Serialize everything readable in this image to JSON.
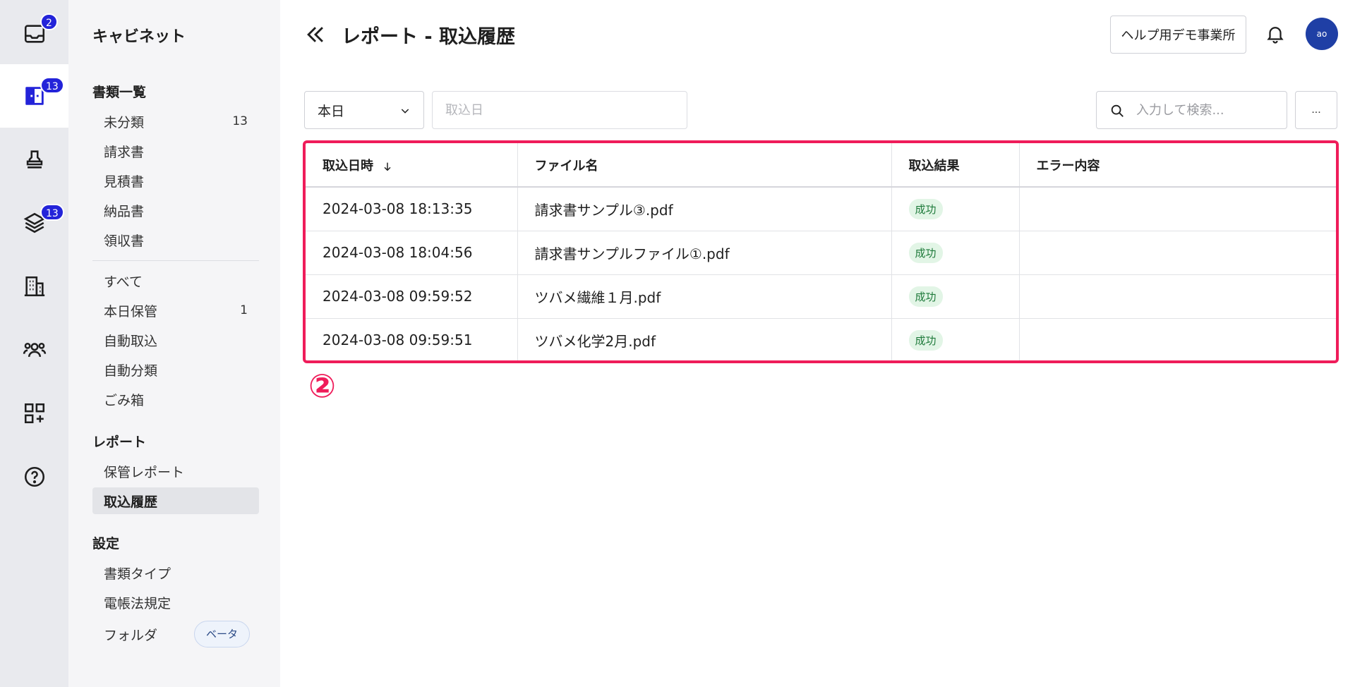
{
  "rail": {
    "items": [
      {
        "icon": "inbox-icon",
        "badge": "2"
      },
      {
        "icon": "cabinet-icon",
        "badge": "13"
      },
      {
        "icon": "stamp-icon",
        "badge": ""
      },
      {
        "icon": "layers-icon",
        "badge": "13"
      },
      {
        "icon": "building-icon",
        "badge": ""
      },
      {
        "icon": "users-icon",
        "badge": ""
      },
      {
        "icon": "apps-icon",
        "badge": ""
      },
      {
        "icon": "help-icon",
        "badge": ""
      }
    ]
  },
  "sidebar": {
    "title": "キャビネット",
    "sections": {
      "documents": "書類一覧",
      "reports": "レポート",
      "settings": "設定"
    },
    "doc_items": [
      {
        "label": "未分類",
        "count": "13"
      },
      {
        "label": "請求書",
        "count": ""
      },
      {
        "label": "見積書",
        "count": ""
      },
      {
        "label": "納品書",
        "count": ""
      },
      {
        "label": "領収書",
        "count": ""
      }
    ],
    "other_items": [
      {
        "label": "すべて",
        "count": ""
      },
      {
        "label": "本日保管",
        "count": "1"
      },
      {
        "label": "自動取込",
        "count": ""
      },
      {
        "label": "自動分類",
        "count": ""
      },
      {
        "label": "ごみ箱",
        "count": ""
      }
    ],
    "report_items": [
      {
        "label": "保管レポート"
      },
      {
        "label": "取込履歴"
      }
    ],
    "setting_items": [
      {
        "label": "書類タイプ"
      },
      {
        "label": "電帳法規定"
      },
      {
        "label": "フォルダ",
        "tag": "ベータ"
      }
    ]
  },
  "header": {
    "title": "レポート - 取込履歴",
    "office": "ヘルプ用デモ事業所",
    "avatar": "ao"
  },
  "filters": {
    "period": "本日",
    "date_placeholder": "取込日",
    "search_placeholder": "入力して検索...",
    "more_label": "..."
  },
  "table": {
    "columns": [
      "取込日時",
      "ファイル名",
      "取込結果",
      "エラー内容"
    ],
    "rows": [
      {
        "datetime": "2024-03-08 18:13:35",
        "file": "請求書サンプル③.pdf",
        "result": "成功",
        "error": ""
      },
      {
        "datetime": "2024-03-08 18:04:56",
        "file": "請求書サンプルファイル①.pdf",
        "result": "成功",
        "error": ""
      },
      {
        "datetime": "2024-03-08 09:59:52",
        "file": "ツバメ繊維１月.pdf",
        "result": "成功",
        "error": ""
      },
      {
        "datetime": "2024-03-08 09:59:51",
        "file": "ツバメ化学2月.pdf",
        "result": "成功",
        "error": ""
      }
    ]
  },
  "annotation": {
    "number": "②",
    "color": "#ef1c5a"
  }
}
